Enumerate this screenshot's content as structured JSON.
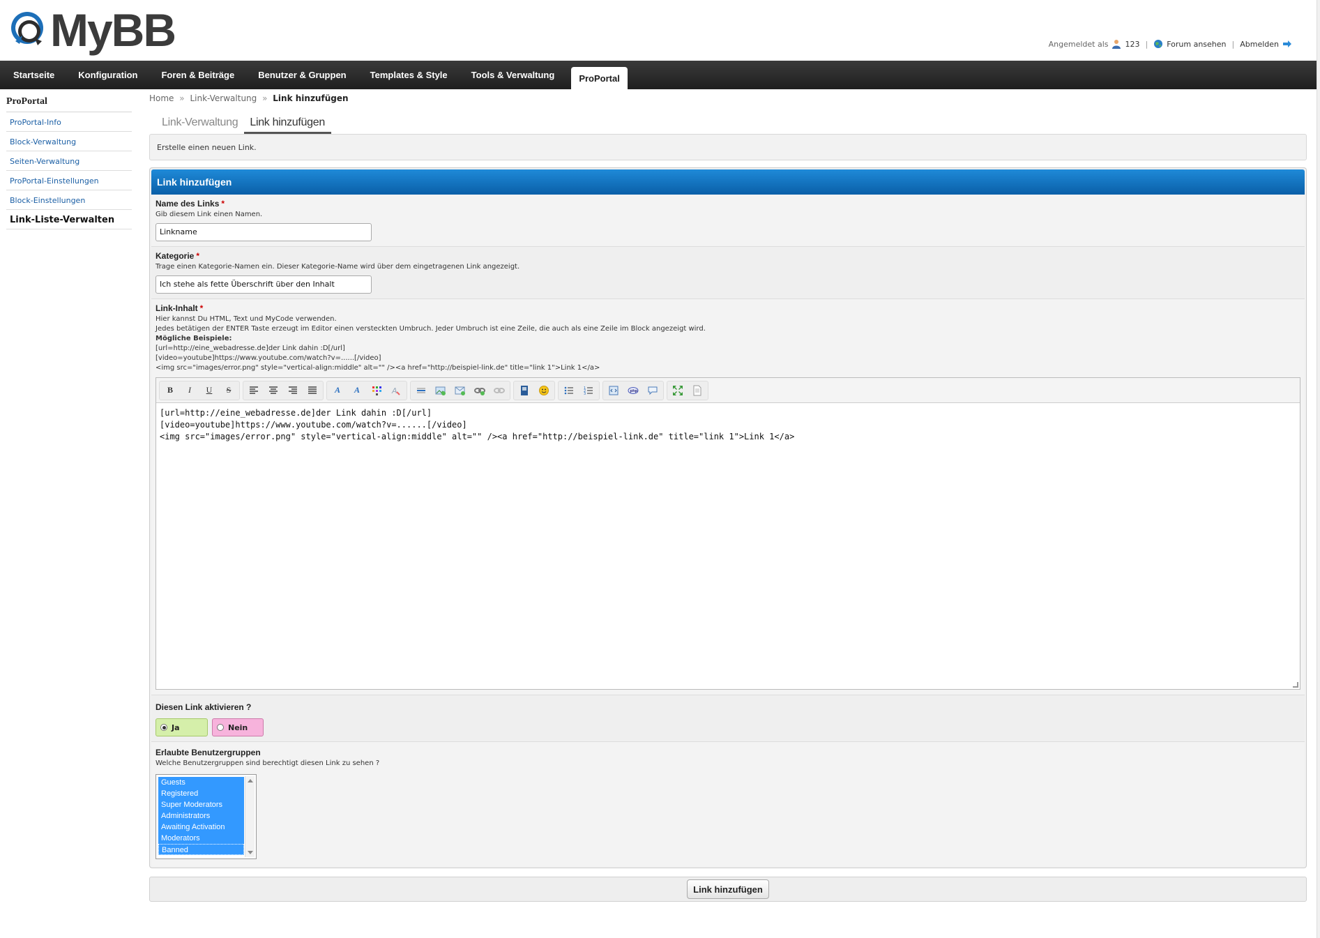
{
  "header": {
    "logo_text": "MyBB",
    "logged_in_as": "Angemeldet als",
    "username": "123",
    "view_forum": "Forum ansehen",
    "logout": "Abmelden"
  },
  "nav": {
    "items": [
      "Startseite",
      "Konfiguration",
      "Foren & Beiträge",
      "Benutzer & Gruppen",
      "Templates & Style",
      "Tools & Verwaltung",
      "ProPortal"
    ]
  },
  "sidebar": {
    "title": "ProPortal",
    "items": [
      "ProPortal-Info",
      "Block-Verwaltung",
      "Seiten-Verwaltung",
      "ProPortal-Einstellungen",
      "Block-Einstellungen",
      "Link-Liste-Verwalten"
    ]
  },
  "breadcrumb": {
    "home": "Home",
    "sep": "»",
    "mid": "Link-Verwaltung",
    "current": "Link hinzufügen"
  },
  "tabs": [
    "Link-Verwaltung",
    "Link hinzufügen"
  ],
  "description": "Erstelle einen neuen Link.",
  "form": {
    "heading": "Link hinzufügen",
    "name": {
      "label": "Name des Links",
      "req": "*",
      "desc": "Gib diesem Link einen Namen.",
      "value": "Linkname"
    },
    "category": {
      "label": "Kategorie",
      "req": "*",
      "desc": "Trage einen Kategorie-Namen ein. Dieser Kategorie-Name wird über dem eingetragenen Link angezeigt.",
      "value": "Ich stehe als fette Überschrift über den Inhalt"
    },
    "content": {
      "label": "Link-Inhalt",
      "req": "*",
      "desc1": "Hier kannst Du HTML, Text und MyCode verwenden.",
      "desc2": "Jedes betätigen der ENTER Taste erzeugt im Editor einen versteckten Umbruch. Jeder Umbruch ist eine Zeile, die auch als eine Zeile im Block angezeigt wird.",
      "examples_title": "Mögliche Beispiele:",
      "ex1": "[url=http://eine_webadresse.de]der Link dahin :D[/url]",
      "ex2": "[video=youtube]https://www.youtube.com/watch?v=......[/video]",
      "ex3": "<img src=\"images/error.png\" style=\"vertical-align:middle\" alt=\"\" /><a href=\"http://beispiel-link.de\" title=\"link 1\">Link 1</a>",
      "editor_value": "[url=http://eine_webadresse.de]der Link dahin :D[/url]\n[video=youtube]https://www.youtube.com/watch?v=......[/video]\n<img src=\"images/error.png\" style=\"vertical-align:middle\" alt=\"\" /><a href=\"http://beispiel-link.de\" title=\"link 1\">Link 1</a>"
    },
    "activate": {
      "label": "Diesen Link aktivieren ?",
      "yes": "Ja",
      "no": "Nein",
      "selected": "Ja"
    },
    "groups": {
      "label": "Erlaubte Benutzergruppen",
      "desc": "Welche Benutzergruppen sind berechtigt diesen Link zu sehen ?",
      "options": [
        "Guests",
        "Registered",
        "Super Moderators",
        "Administrators",
        "Awaiting Activation",
        "Moderators",
        "Banned"
      ]
    },
    "submit": "Link hinzufügen"
  },
  "colors": {
    "nav_bg": "#2a2a2a",
    "head_blue": "#0d6cb8",
    "link_blue": "#1b5fa5",
    "yes_bg": "#d5efaa",
    "no_bg": "#f7b3dc",
    "select_blue": "#3399ff"
  }
}
